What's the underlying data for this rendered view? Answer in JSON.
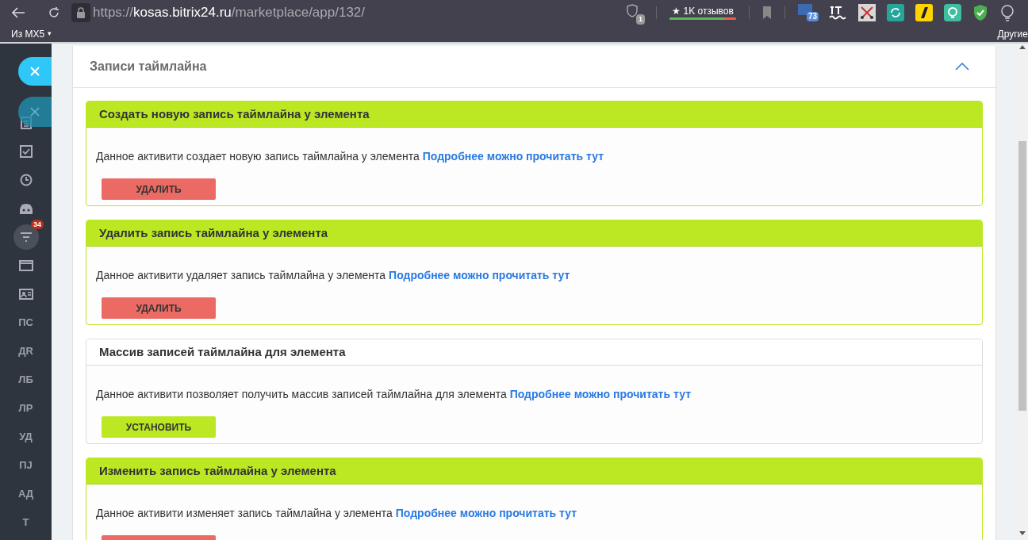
{
  "browser": {
    "url_scheme": "https://",
    "url_host": "kosas.bitrix24.ru",
    "url_path": "/marketplace/app/132/",
    "shield_badge": "1",
    "reviews": "★ 1K отзывов",
    "rating": {
      "level": 0.82
    },
    "extension_badge": "73"
  },
  "bookmarks": {
    "folder": "Из MX5",
    "caret": "▾",
    "other": "Другие"
  },
  "sidebar": {
    "items": [
      {
        "kind": "icon"
      },
      {
        "kind": "icon"
      },
      {
        "kind": "icon"
      },
      {
        "kind": "icon"
      },
      {
        "kind": "icon",
        "badge": "34"
      },
      {
        "kind": "icon"
      },
      {
        "kind": "icon"
      },
      {
        "kind": "text",
        "label": "ПС"
      },
      {
        "kind": "text",
        "label": "ДR"
      },
      {
        "kind": "text",
        "label": "ЛБ"
      },
      {
        "kind": "text",
        "label": "ЛР"
      },
      {
        "kind": "text",
        "label": "УД"
      },
      {
        "kind": "text",
        "label": "ПJ"
      },
      {
        "kind": "text",
        "label": "АД"
      },
      {
        "kind": "text",
        "label": "Т"
      }
    ]
  },
  "section": {
    "title": "Записи таймлайна",
    "expanded": true
  },
  "cards": [
    {
      "title": "Создать новую запись таймлайна у элемента",
      "highlighted": true,
      "description": "Данное активити создает новую запись таймлайна у элемента",
      "link": "Подробнее можно прочитать тут",
      "button": {
        "kind": "delete",
        "label": "УДАЛИТЬ"
      }
    },
    {
      "title": "Удалить запись таймлайна у элемента",
      "highlighted": true,
      "description": "Данное активити удаляет запись таймлайна у элемента",
      "link": "Подробнее можно прочитать тут",
      "button": {
        "kind": "delete",
        "label": "УДАЛИТЬ"
      }
    },
    {
      "title": "Массив записей таймлайна для элемента",
      "highlighted": false,
      "description": "Данное активити позволяет получить массив записей таймлайна для элемента",
      "link": "Подробнее можно прочитать тут",
      "button": {
        "kind": "install",
        "label": "УСТАНОВИТЬ"
      }
    },
    {
      "title": "Изменить запись таймлайна у элемента",
      "highlighted": true,
      "description": "Данное активити изменяет запись таймлайна у элемента",
      "link": "Подробнее можно прочитать тут",
      "button": {
        "kind": "delete"
      }
    }
  ]
}
